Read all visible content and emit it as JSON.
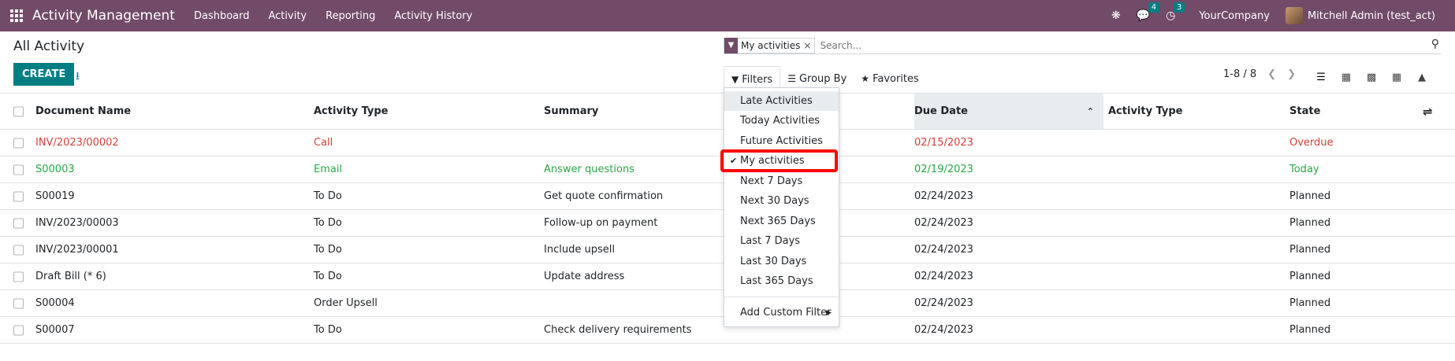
{
  "navbar": {
    "app_title": "Activity Management",
    "menu": [
      "Dashboard",
      "Activity",
      "Reporting",
      "Activity History"
    ],
    "messages_count": "4",
    "activities_count": "3",
    "company": "YourCompany",
    "user": "Mitchell Admin (test_act)"
  },
  "page": {
    "title": "All Activity",
    "create_label": "CREATE"
  },
  "search": {
    "facet_label": "My activities",
    "placeholder": "Search..."
  },
  "filters": {
    "filters_label": "Filters",
    "groupby_label": "Group By",
    "favorites_label": "Favorites"
  },
  "pager": {
    "range": "1-8 / 8"
  },
  "table": {
    "headers": [
      "Document Name",
      "Activity Type",
      "Summary",
      "Due Date",
      "Activity Type",
      "State"
    ],
    "rows": [
      {
        "doc": "INV/2023/00002",
        "type": "Call",
        "summary": "",
        "due": "02/15/2023",
        "type2": "",
        "state": "Overdue"
      },
      {
        "doc": "S00003",
        "type": "Email",
        "summary": "Answer questions",
        "due": "02/19/2023",
        "type2": "",
        "state": "Today"
      },
      {
        "doc": "S00019",
        "type": "To Do",
        "summary": "Get quote confirmation",
        "due": "02/24/2023",
        "type2": "",
        "state": "Planned"
      },
      {
        "doc": "INV/2023/00003",
        "type": "To Do",
        "summary": "Follow-up on payment",
        "due": "02/24/2023",
        "type2": "",
        "state": "Planned"
      },
      {
        "doc": "INV/2023/00001",
        "type": "To Do",
        "summary": "Include upsell",
        "due": "02/24/2023",
        "type2": "",
        "state": "Planned"
      },
      {
        "doc": "Draft Bill (* 6)",
        "type": "To Do",
        "summary": "Update address",
        "due": "02/24/2023",
        "type2": "",
        "state": "Planned"
      },
      {
        "doc": "S00004",
        "type": "Order Upsell",
        "summary": "",
        "due": "02/24/2023",
        "type2": "",
        "state": "Planned"
      },
      {
        "doc": "S00007",
        "type": "To Do",
        "summary": "Check delivery requirements",
        "due": "02/24/2023",
        "type2": "",
        "state": "Planned"
      }
    ]
  },
  "dropdown": {
    "items": [
      "Late Activities",
      "Today Activities",
      "Future Activities",
      "My activities",
      "Next 7 Days",
      "Next 30 Days",
      "Next 365 Days",
      "Last 7 Days",
      "Last 30 Days",
      "Last 365 Days"
    ],
    "custom_filter": "Add Custom Filter"
  },
  "colors": {
    "brand": "#714B67",
    "accent": "#017e84",
    "overdue": "#d23f3a",
    "today": "#28a745",
    "highlight": "#ff0000"
  }
}
